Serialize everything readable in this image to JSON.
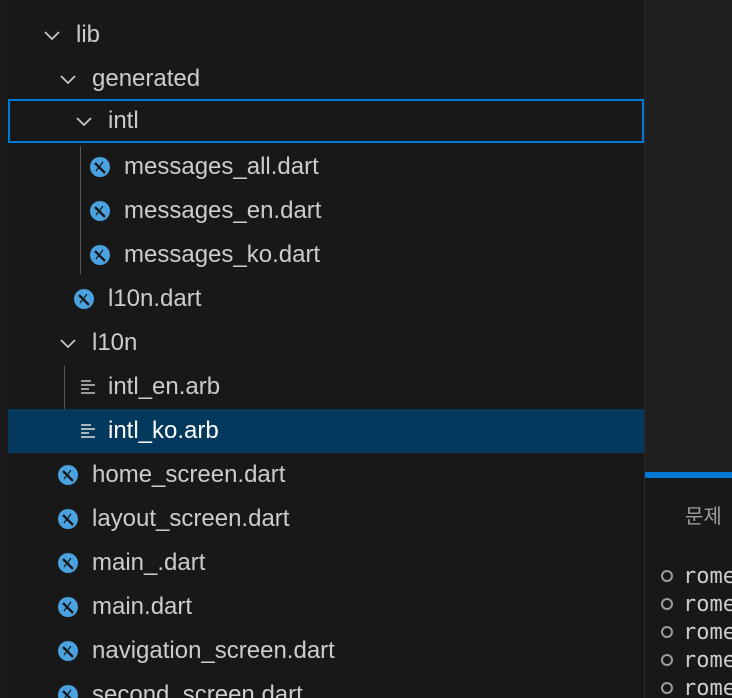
{
  "explorer": {
    "rows": [
      {
        "label": "lib",
        "kind": "folder",
        "icon": "chevron-down-icon"
      },
      {
        "label": "generated",
        "kind": "folder",
        "icon": "chevron-down-icon"
      },
      {
        "label": "intl",
        "kind": "folder",
        "icon": "chevron-down-icon",
        "state": "focused"
      },
      {
        "label": "messages_all.dart",
        "kind": "file",
        "icon": "dart-file-icon"
      },
      {
        "label": "messages_en.dart",
        "kind": "file",
        "icon": "dart-file-icon"
      },
      {
        "label": "messages_ko.dart",
        "kind": "file",
        "icon": "dart-file-icon"
      },
      {
        "label": "l10n.dart",
        "kind": "file",
        "icon": "dart-file-icon"
      },
      {
        "label": "l10n",
        "kind": "folder",
        "icon": "chevron-down-icon"
      },
      {
        "label": "intl_en.arb",
        "kind": "file",
        "icon": "lines-file-icon"
      },
      {
        "label": "intl_ko.arb",
        "kind": "file",
        "icon": "lines-file-icon",
        "state": "selected"
      },
      {
        "label": "home_screen.dart",
        "kind": "file",
        "icon": "dart-file-icon"
      },
      {
        "label": "layout_screen.dart",
        "kind": "file",
        "icon": "dart-file-icon"
      },
      {
        "label": "main_.dart",
        "kind": "file",
        "icon": "dart-file-icon"
      },
      {
        "label": "main.dart",
        "kind": "file",
        "icon": "dart-file-icon"
      },
      {
        "label": "navigation_screen.dart",
        "kind": "file",
        "icon": "dart-file-icon"
      },
      {
        "label": "second_screen.dart",
        "kind": "file",
        "icon": "dart-file-icon"
      }
    ]
  },
  "panel": {
    "tab_label": "문제",
    "terminal_lines": [
      "rome",
      "rome",
      "rome",
      "rome",
      "rome"
    ]
  },
  "colors": {
    "background": "#181818",
    "focus_border": "#0078d4",
    "selected_background": "#04395e",
    "dart_icon": "#4aa3df"
  }
}
